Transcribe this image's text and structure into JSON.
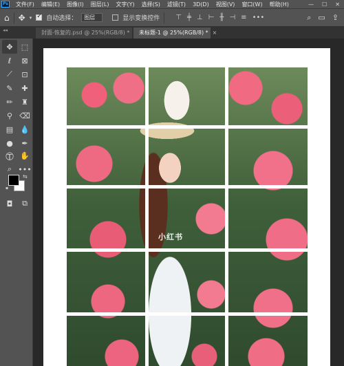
{
  "app": {
    "logo": "Ps"
  },
  "menu": [
    "文件(F)",
    "编辑(E)",
    "图像(I)",
    "图层(L)",
    "文字(Y)",
    "选择(S)",
    "滤镜(T)",
    "3D(D)",
    "视图(V)",
    "窗口(W)",
    "帮助(H)"
  ],
  "options": {
    "auto_select_label": "自动选择：",
    "auto_select_checked": true,
    "auto_select_value": "图层",
    "show_transform_label": "显示变换控件",
    "show_transform_checked": false
  },
  "tabs": [
    {
      "label": "封面-恢复的.psd @ 25%(RGB/8) *",
      "active": false
    },
    {
      "label": "未标题-1 @ 25%(RGB/8) *",
      "active": true
    }
  ],
  "canvas": {
    "watermark": "小红书",
    "grid": {
      "columns": 3,
      "rows": 5
    }
  },
  "colors": {
    "foreground": "#000000",
    "background": "#ffffff"
  }
}
